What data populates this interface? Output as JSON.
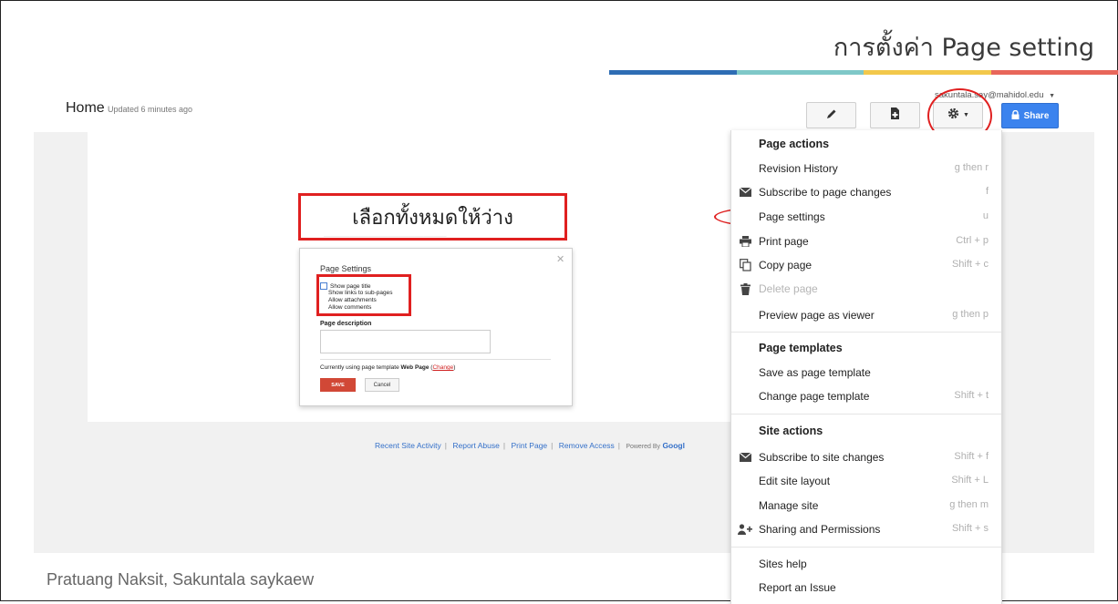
{
  "slide": {
    "title": "การตั้งค่า Page setting",
    "author": "Pratuang Naksit, Sakuntala saykaew",
    "stripe_colors": [
      "#2e6db4",
      "#7fc8c8",
      "#f2c84b",
      "#e8665a"
    ],
    "annotation_color": "#e02020"
  },
  "header": {
    "page_name": "Home",
    "updated": "Updated 6 minutes ago",
    "account": "sakuntala.say@mahidol.edu",
    "share_label": "Share",
    "edit_icon": "pencil-icon",
    "new_page_icon": "new-page-icon",
    "more_icon": "gear-icon"
  },
  "callout": {
    "text": "เลือกทั้งหมดให้ว่าง"
  },
  "dialog": {
    "title": "Page Settings",
    "options": [
      "Show page title",
      "Show links to sub-pages",
      "Allow attachments",
      "Allow comments"
    ],
    "description_label": "Page description",
    "description_value": "",
    "template_prefix": "Currently using page template",
    "template_name": "Web Page",
    "change_link": "Change",
    "save_label": "SAVE",
    "cancel_label": "Cancel"
  },
  "footer": {
    "links": [
      "Recent Site Activity",
      "Report Abuse",
      "Print Page",
      "Remove Access"
    ],
    "powered_by": "Powered By",
    "powered_brand": "Googl"
  },
  "menu": {
    "page_actions_header": "Page actions",
    "page_actions": [
      {
        "label": "Revision History",
        "shortcut": "g then r",
        "icon": ""
      },
      {
        "label": "Subscribe to page changes",
        "shortcut": "f",
        "icon": "envelope-icon"
      },
      {
        "label": "Page settings",
        "shortcut": "u",
        "icon": ""
      },
      {
        "label": "Print page",
        "shortcut": "Ctrl + p",
        "icon": "printer-icon"
      },
      {
        "label": "Copy page",
        "shortcut": "Shift + c",
        "icon": "copy-icon"
      },
      {
        "label": "Delete page",
        "shortcut": "",
        "icon": "trash-icon",
        "disabled": true
      },
      {
        "label": "Preview page as viewer",
        "shortcut": "g then p",
        "icon": ""
      }
    ],
    "page_templates_header": "Page templates",
    "page_templates": [
      {
        "label": "Save as page template",
        "shortcut": ""
      },
      {
        "label": "Change page template",
        "shortcut": "Shift + t"
      }
    ],
    "site_actions_header": "Site actions",
    "site_actions": [
      {
        "label": "Subscribe to site changes",
        "shortcut": "Shift + f",
        "icon": "envelope-icon"
      },
      {
        "label": "Edit site layout",
        "shortcut": "Shift + L",
        "icon": ""
      },
      {
        "label": "Manage site",
        "shortcut": "g then m",
        "icon": ""
      },
      {
        "label": "Sharing and Permissions",
        "shortcut": "Shift + s",
        "icon": "add-user-icon"
      }
    ],
    "help_items": [
      {
        "label": "Sites help"
      },
      {
        "label": "Report an Issue"
      }
    ]
  }
}
